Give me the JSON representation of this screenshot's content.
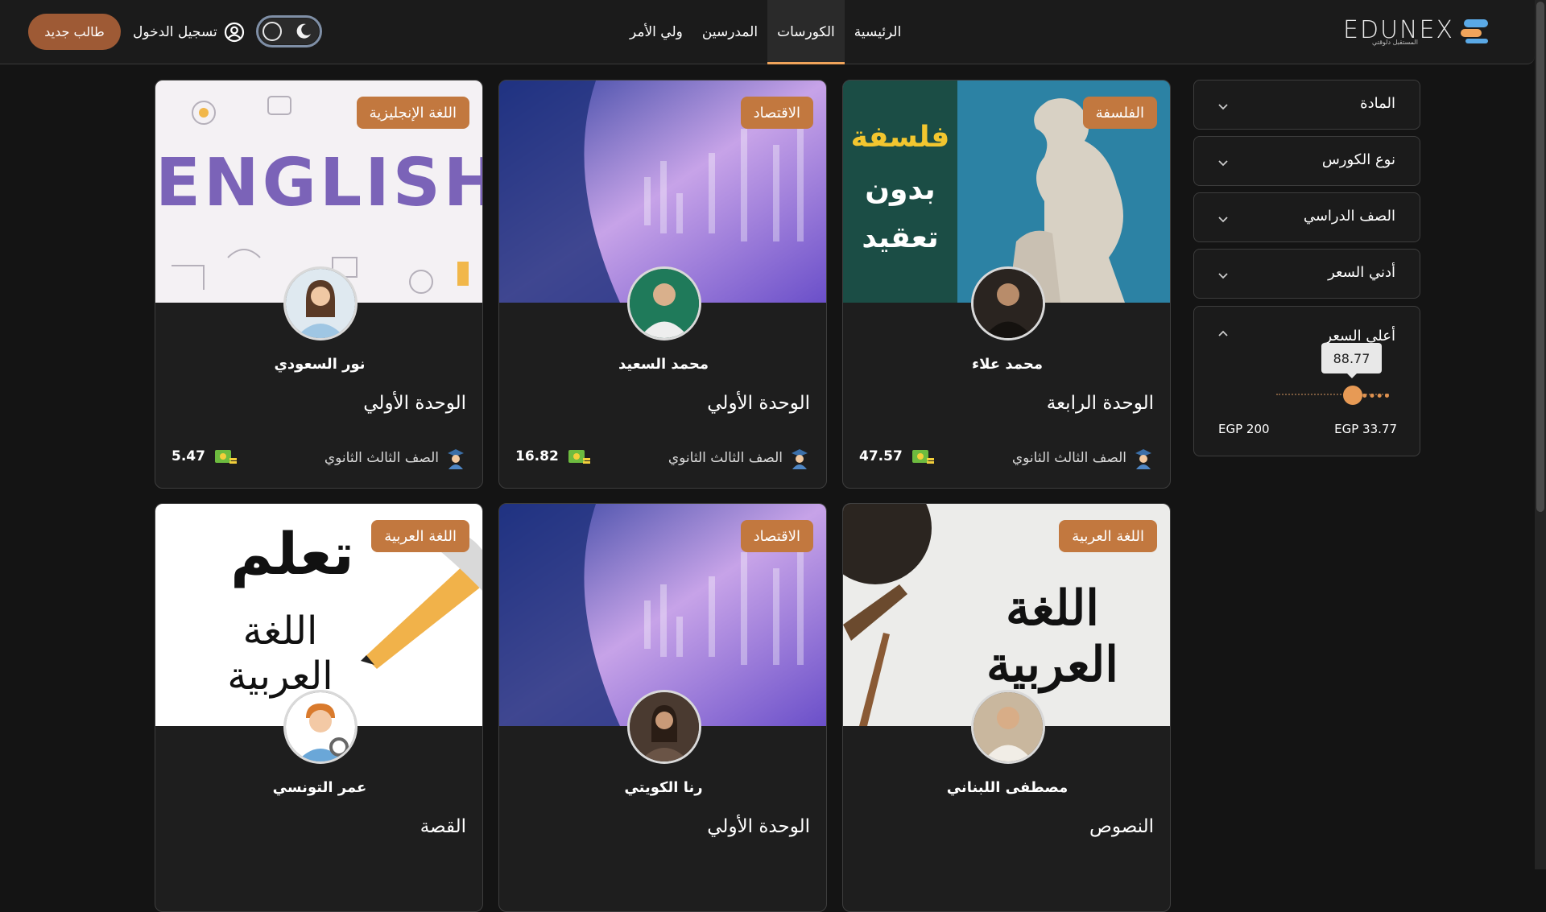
{
  "brand": {
    "name": "EDUNEX",
    "tagline": "المستقبل دلوقتي"
  },
  "nav": {
    "items": [
      {
        "label": "الرئيسية"
      },
      {
        "label": "الكورسات",
        "active": true
      },
      {
        "label": "المدرسين"
      },
      {
        "label": "ولي الأمر"
      }
    ]
  },
  "header": {
    "login_label": "تسجيل الدخول",
    "register_label": "طالب جديد",
    "theme_toggle": "dark"
  },
  "filters": {
    "subject": "المادة",
    "course_type": "نوع الكورس",
    "grade": "الصف الدراسي",
    "min_price": "أدني السعر",
    "max_price": {
      "label": "أعلى السعر",
      "value": "88.77",
      "min_label": "EGP 33.77",
      "max_label": "EGP 200"
    }
  },
  "courses": [
    {
      "subject": "الفلسفة",
      "teacher": "محمد علاء",
      "unit": "الوحدة الرابعة",
      "grade": "الصف الثالث الثانوي",
      "price": "47.57"
    },
    {
      "subject": "الاقتصاد",
      "teacher": "محمد السعيد",
      "unit": "الوحدة الأولي",
      "grade": "الصف الثالث الثانوي",
      "price": "16.82"
    },
    {
      "subject": "اللغة الإنجليزية",
      "teacher": "نور السعودي",
      "unit": "الوحدة الأولي",
      "grade": "الصف الثالث الثانوي",
      "price": "5.47"
    },
    {
      "subject": "اللغة العربية",
      "teacher": "مصطفى اللبناني",
      "unit": "النصوص"
    },
    {
      "subject": "الاقتصاد",
      "teacher": "رنا الكويتي",
      "unit": "الوحدة الأولي"
    },
    {
      "subject": "اللغة العربية",
      "teacher": "عمر التونسي",
      "unit": "القصة"
    }
  ],
  "thumb_text": {
    "philosophy": [
      "فلسفة",
      "بدون",
      "تعقيد"
    ],
    "english": "ENGLISH",
    "learn": "تعلم",
    "arabic_calligraphy": "اللغة العربية"
  },
  "colors": {
    "accent": "#c2783f",
    "background": "#141414",
    "card": "#1e1e1e"
  }
}
